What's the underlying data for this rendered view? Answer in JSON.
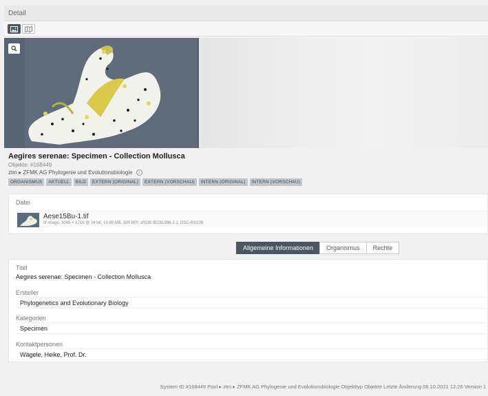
{
  "window": {
    "title": "Detail"
  },
  "toolbar": {
    "buttons": [
      {
        "icon": "image-icon",
        "active": true
      },
      {
        "icon": "map-icon",
        "active": false
      }
    ]
  },
  "hero": {
    "zoom_icon": "zoom-in-icon"
  },
  "record": {
    "title": "Aegires serenae: Specimen - Collection Mollusca",
    "objekte": "Objekte: #168449",
    "path": "ztm ▸ ZFMK AG Phylogenie und Evolutionsbiologie",
    "tags": [
      "ORGANISMUS",
      "AKTUELL",
      "BILD",
      "EXTERN (ORIGINAL)",
      "EXTERN (VORSCHAU)",
      "INTERN (ORIGINAL)",
      "INTERN (VORSCHAU)"
    ]
  },
  "file": {
    "label": "Datei",
    "name": "Aese15Bu-1.tif",
    "details": "tif image, 3045 × 1716 @ 24 bit, 14.88 MB, 300 DPI, sRGB IEC61966-2.1, DSC-RX100"
  },
  "tabs": [
    {
      "label": "Allgemeine Informationen",
      "active": true
    },
    {
      "label": "Organismus",
      "active": false
    },
    {
      "label": "Rechte",
      "active": false
    }
  ],
  "fields": {
    "titel_label": "Titel",
    "titel_value": "Aegires serenae: Specimen - Collection Mollusca",
    "ersteller_label": "Ersteller",
    "ersteller_value": "Phylogenetics and Evolutionary Biology",
    "kategorien_label": "Kategorien",
    "kategorien_value": "Specimen",
    "kontakt_label": "Kontaktpersonen",
    "kontakt_value": "Wägele, Heike, Prof. Dr."
  },
  "footer": {
    "text": "System-ID #168449   Pool ▸ ztm ▸ ZFMK AG Phylogenie und Evolutionsbiologie   Objekttyp Objekte   Letzte Änderung 06.10.2021 12:26   Version 1"
  },
  "colors": {
    "accent": "#4a5663",
    "tag_bg": "#c2c7cc"
  }
}
